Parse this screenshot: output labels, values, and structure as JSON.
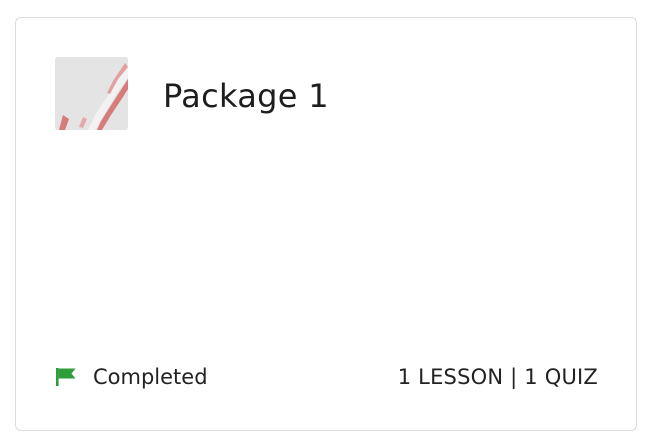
{
  "package": {
    "title": "Package 1",
    "thumbnail_icon": "package-thumbnail-image",
    "status": {
      "label": "Completed",
      "icon": "flag-icon",
      "color": "#2e9e3a"
    },
    "meta": "1 LESSON | 1 QUIZ"
  },
  "colors": {
    "border": "#dcdcdc",
    "text": "#1d1d1d",
    "accent": "#d76b6b"
  }
}
